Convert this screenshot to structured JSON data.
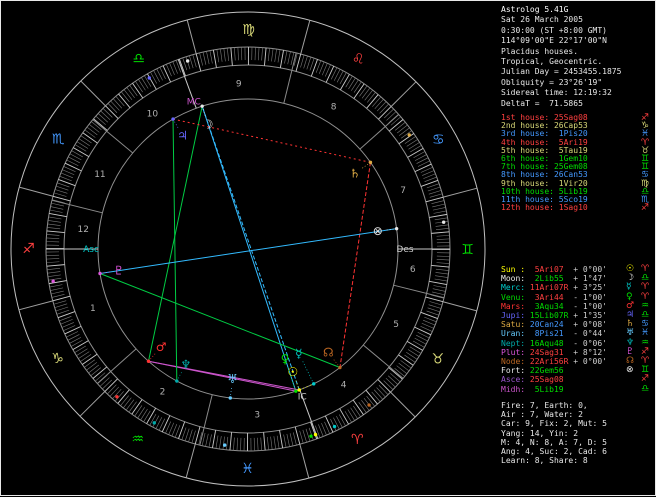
{
  "sidebar": {
    "info": [
      "Astrolog 5.41G",
      "Sat 26 March 2005",
      "0:30:00 (ST +8:00 GMT)",
      "114°09'00\"E 22°17'00\"N",
      "Placidus houses.",
      "Tropical, Geocentric.",
      "Julian Day = 2453455.1875",
      "Obliquity = 23°26'19\"",
      "Sidereal time: 12:19:32",
      "DeltaT =  71.5865"
    ],
    "houses": [
      {
        "label": "1st house: ",
        "value": "25Sag08",
        "sign": "♐",
        "element": "fire"
      },
      {
        "label": "2nd house: ",
        "value": "26Cap53",
        "sign": "♑",
        "element": "earth"
      },
      {
        "label": "3rd house: ",
        "value": " 1Pis20",
        "sign": "♓",
        "element": "water"
      },
      {
        "label": "4th house: ",
        "value": " 5Ari19",
        "sign": "♈",
        "element": "fire"
      },
      {
        "label": "5th house: ",
        "value": " 5Tau19",
        "sign": "♉",
        "element": "earth"
      },
      {
        "label": "6th house: ",
        "value": " 1Gem10",
        "sign": "♊",
        "element": "air"
      },
      {
        "label": "7th house: ",
        "value": "25Gem08",
        "sign": "♊",
        "element": "air"
      },
      {
        "label": "8th house: ",
        "value": "26Can53",
        "sign": "♋",
        "element": "water"
      },
      {
        "label": "9th house: ",
        "value": " 1Vir20",
        "sign": "♍",
        "element": "earth"
      },
      {
        "label": "10th house:",
        "value": " 5Lib19",
        "sign": "♎",
        "element": "air"
      },
      {
        "label": "11th house:",
        "value": " 5Sco19",
        "sign": "♏",
        "element": "water"
      },
      {
        "label": "12th house:",
        "value": " 1Sag10",
        "sign": "♐",
        "element": "fire"
      }
    ],
    "planets": [
      {
        "name": "Sun : ",
        "value": " 5Ari07 ",
        "vel": " + 0°00'",
        "glyph": "☉",
        "sign": "♈",
        "obj": "sun",
        "element": "fire"
      },
      {
        "name": "Moon: ",
        "value": " 2Lib55 ",
        "vel": " + 1°47'",
        "glyph": "☽",
        "sign": "♎",
        "obj": "moon",
        "element": "air"
      },
      {
        "name": "Merc: ",
        "value": "11Ari07R",
        "vel": " + 3°25'",
        "glyph": "☿",
        "sign": "♈",
        "obj": "merc",
        "element": "fire"
      },
      {
        "name": "Venu: ",
        "value": " 3Ari44 ",
        "vel": " - 1°00'",
        "glyph": "♀",
        "sign": "♈",
        "obj": "venu",
        "element": "fire"
      },
      {
        "name": "Mars: ",
        "value": " 3Aqu34 ",
        "vel": " - 1°00'",
        "glyph": "♂",
        "sign": "♒",
        "obj": "mars",
        "element": "air"
      },
      {
        "name": "Jupi: ",
        "value": "15Lib07R",
        "vel": " + 1°35'",
        "glyph": "♃",
        "sign": "♎",
        "obj": "jupi",
        "element": "air"
      },
      {
        "name": "Satu: ",
        "value": "20Can24 ",
        "vel": " + 0°08'",
        "glyph": "♄",
        "sign": "♋",
        "obj": "satu",
        "element": "water"
      },
      {
        "name": "Uran: ",
        "value": " 8Pis21 ",
        "vel": " - 0°44'",
        "glyph": "♅",
        "sign": "♓",
        "obj": "uran",
        "element": "water"
      },
      {
        "name": "Nept: ",
        "value": "16Aqu48 ",
        "vel": " - 0°06'",
        "glyph": "♆",
        "sign": "♒",
        "obj": "nept",
        "element": "air"
      },
      {
        "name": "Plut: ",
        "value": "24Sag31 ",
        "vel": " + 8°12'",
        "glyph": "♇",
        "sign": "♐",
        "obj": "plut",
        "element": "fire"
      },
      {
        "name": "Node: ",
        "value": "22Ari56R",
        "vel": " + 0°00'",
        "glyph": "☊",
        "sign": "♈",
        "obj": "node",
        "element": "fire"
      },
      {
        "name": "Fort: ",
        "value": "22Gem56 ",
        "vel": "",
        "glyph": "⊗",
        "sign": "♊",
        "obj": "fort",
        "element": "air"
      },
      {
        "name": "Asce: ",
        "value": "25Sag08 ",
        "vel": "",
        "glyph": "",
        "sign": "♐",
        "obj": "asce",
        "element": "fire"
      },
      {
        "name": "Midh: ",
        "value": " 5Lib19 ",
        "vel": "",
        "glyph": "",
        "sign": "♎",
        "obj": "midh",
        "element": "air"
      }
    ],
    "stats": [
      "Fire: 7, Earth: 0,",
      "Air : 7, Water: 2",
      "Car: 9, Fix: 2, Mut: 5",
      "Yang: 14, Yin: 2",
      "M: 4, N: 8, A: 7, D: 5",
      "Ang: 4, Suc: 2, Cad: 6",
      "Learn: 8, Share: 8"
    ]
  },
  "colors": {
    "elements": {
      "fire": "#ff4040",
      "earth": "#d8d878",
      "air": "#00dd00",
      "water": "#4499ff"
    },
    "objects": {
      "sun": "#ffff00",
      "moon": "#e8e8e8",
      "merc": "#00cccc",
      "venu": "#00dd00",
      "mars": "#ff3333",
      "jupi": "#6666ff",
      "satu": "#ddaa44",
      "uran": "#66ccff",
      "nept": "#00aaaa",
      "plut": "#dd55dd",
      "node": "#bb6622",
      "fort": "#e8e8e8",
      "asce": "#9955cc",
      "midh": "#cc55cc"
    },
    "aspects": {
      "Con": "#cccc00",
      "Sex": "#cc55cc",
      "Squ": "#ff3333",
      "Tri": "#00cc44",
      "Opp": "#33bbff"
    },
    "wheel_lines": "#909090",
    "ticks": "#cccccc",
    "house_numbers": "#b0b0b0",
    "vel_text": "#d0d0d0"
  },
  "wheel": {
    "asc_lon": 255.13,
    "signs": [
      {
        "glyph": "♈",
        "element": "fire"
      },
      {
        "glyph": "♉",
        "element": "earth"
      },
      {
        "glyph": "♊",
        "element": "air"
      },
      {
        "glyph": "♋",
        "element": "water"
      },
      {
        "glyph": "♌",
        "element": "fire"
      },
      {
        "glyph": "♍",
        "element": "earth"
      },
      {
        "glyph": "♎",
        "element": "air"
      },
      {
        "glyph": "♏",
        "element": "water"
      },
      {
        "glyph": "♐",
        "element": "fire"
      },
      {
        "glyph": "♑",
        "element": "earth"
      },
      {
        "glyph": "♒",
        "element": "air"
      },
      {
        "glyph": "♓",
        "element": "water"
      }
    ],
    "house_cusps": [
      255.13,
      296.88,
      331.33,
      5.32,
      35.32,
      61.17,
      75.13,
      116.88,
      151.33,
      185.32,
      215.32,
      241.17
    ],
    "house_numbers": [
      "1",
      "2",
      "3",
      "4",
      "5",
      "6",
      "7",
      "8",
      "9",
      "10",
      "11",
      "12"
    ],
    "planets": [
      {
        "obj": "sun",
        "glyph": "☉",
        "lon": 5.12
      },
      {
        "obj": "moon",
        "glyph": "☽",
        "lon": 182.92
      },
      {
        "obj": "merc",
        "glyph": "☿",
        "lon": 11.12
      },
      {
        "obj": "venu",
        "glyph": "♀",
        "lon": 3.73
      },
      {
        "obj": "mars",
        "glyph": "♂",
        "lon": 303.57
      },
      {
        "obj": "jupi",
        "glyph": "♃",
        "lon": 195.12
      },
      {
        "obj": "satu",
        "glyph": "♄",
        "lon": 110.4
      },
      {
        "obj": "uran",
        "glyph": "♅",
        "lon": 338.35
      },
      {
        "obj": "nept",
        "glyph": "♆",
        "lon": 316.8
      },
      {
        "obj": "plut",
        "glyph": "♇",
        "lon": 264.52
      },
      {
        "obj": "node",
        "glyph": "☊",
        "lon": 22.93
      },
      {
        "obj": "fort",
        "glyph": "⊗",
        "lon": 82.93
      }
    ],
    "angles": [
      {
        "label": "Asc",
        "lon": 255.13,
        "color": "#00cccc"
      },
      {
        "label": "Des",
        "lon": 75.13,
        "color": "#cccccc"
      },
      {
        "label": "MC",
        "lon": 185.32,
        "color": "#cc55cc"
      },
      {
        "label": "IC",
        "lon": 5.32,
        "color": "#cccccc"
      }
    ],
    "aspects": [
      {
        "a": "sun",
        "b": "moon",
        "type": "Opp",
        "dash": "4,2"
      },
      {
        "a": "sun",
        "b": "venu",
        "type": "Con",
        "dash": ""
      },
      {
        "a": "sun",
        "b": "merc",
        "type": "Con",
        "dash": "1,3"
      },
      {
        "a": "moon",
        "b": "venu",
        "type": "Opp",
        "dash": ""
      },
      {
        "a": "moon",
        "b": "mars",
        "type": "Tri",
        "dash": ""
      },
      {
        "a": "mars",
        "b": "sun",
        "type": "Sex",
        "dash": ""
      },
      {
        "a": "mars",
        "b": "venu",
        "type": "Sex",
        "dash": ""
      },
      {
        "a": "jupi",
        "b": "nept",
        "type": "Tri",
        "dash": ""
      },
      {
        "a": "jupi",
        "b": "satu",
        "type": "Squ",
        "dash": "2,3"
      },
      {
        "a": "satu",
        "b": "node",
        "type": "Squ",
        "dash": "4,2"
      },
      {
        "a": "plut",
        "b": "node",
        "type": "Tri",
        "dash": ""
      },
      {
        "a": "plut",
        "b": "fort",
        "type": "Opp",
        "dash": ""
      }
    ],
    "rings": {
      "outer": 237,
      "sign_inner": 202,
      "tick_inner": 184,
      "inner": 150
    }
  }
}
